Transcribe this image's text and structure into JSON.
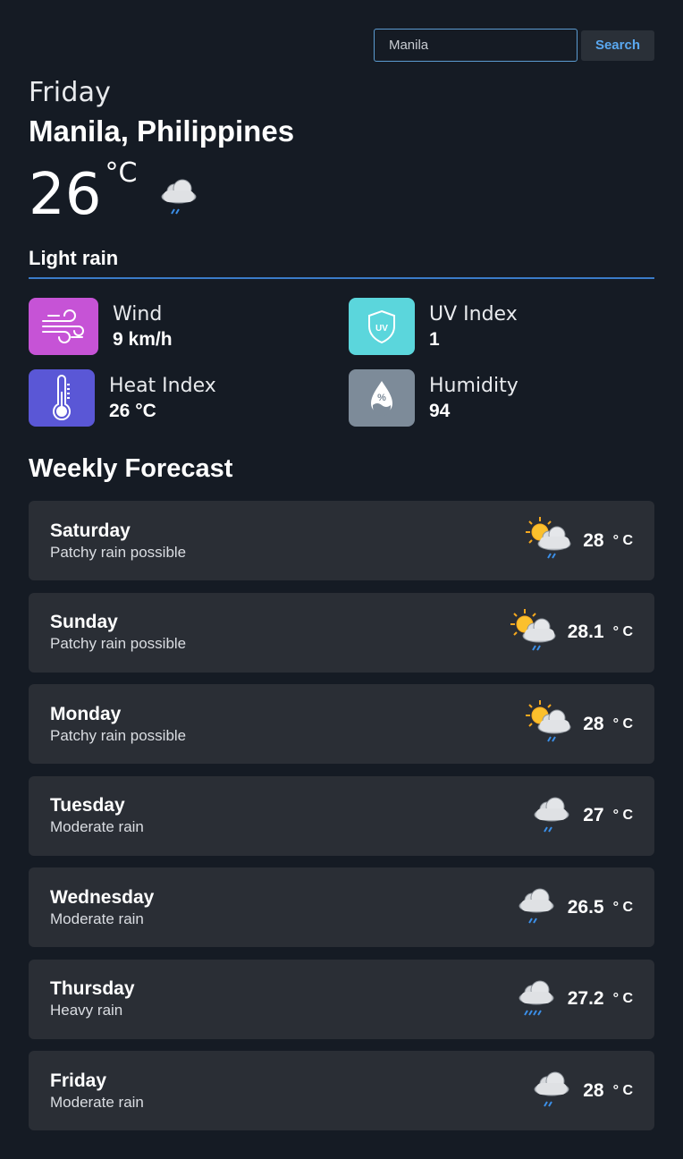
{
  "search": {
    "value": "Manila",
    "placeholder": "Manila",
    "button_label": "Search"
  },
  "current": {
    "day": "Friday",
    "location": "Manila, Philippines",
    "temperature": "26",
    "unit": "°C",
    "icon": "rain-cloud-icon",
    "condition": "Light rain"
  },
  "stats": {
    "wind": {
      "label": "Wind",
      "value": "9 km/h",
      "icon": "wind-icon",
      "color": "#c653d6"
    },
    "uv": {
      "label": "UV Index",
      "value": "1",
      "icon": "uv-shield-icon",
      "color": "#5bd6dc"
    },
    "heat": {
      "label": "Heat Index",
      "value": "26 °C",
      "icon": "thermometer-icon",
      "color": "#5a57d6"
    },
    "humidity": {
      "label": "Humidity",
      "value": "94",
      "icon": "humidity-drop-icon",
      "color": "#7d8b99"
    }
  },
  "weekly": {
    "title": "Weekly Forecast",
    "unit": "° C",
    "days": [
      {
        "day": "Saturday",
        "desc": "Patchy rain possible",
        "temp": "28",
        "icon": "sun-cloud-rain-icon"
      },
      {
        "day": "Sunday",
        "desc": "Patchy rain possible",
        "temp": "28.1",
        "icon": "sun-cloud-rain-icon"
      },
      {
        "day": "Monday",
        "desc": "Patchy rain possible",
        "temp": "28",
        "icon": "sun-cloud-rain-icon"
      },
      {
        "day": "Tuesday",
        "desc": "Moderate rain",
        "temp": "27",
        "icon": "rain-cloud-icon"
      },
      {
        "day": "Wednesday",
        "desc": "Moderate rain",
        "temp": "26.5",
        "icon": "rain-cloud-icon"
      },
      {
        "day": "Thursday",
        "desc": "Heavy rain",
        "temp": "27.2",
        "icon": "heavy-rain-cloud-icon"
      },
      {
        "day": "Friday",
        "desc": "Moderate rain",
        "temp": "28",
        "icon": "rain-cloud-icon"
      }
    ]
  }
}
